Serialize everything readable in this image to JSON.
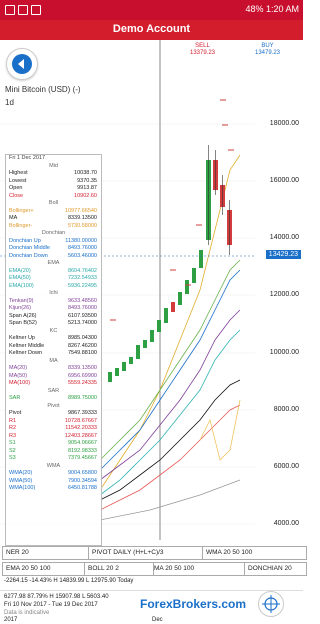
{
  "status": {
    "battery": "48%",
    "time": "1:20 AM"
  },
  "app": {
    "title": "Demo Account"
  },
  "quote": {
    "sell_label": "SELL",
    "sell_price": "13379.23",
    "buy_label": "BUY",
    "buy_price": "13479.23"
  },
  "instrument": {
    "name": "Mini Bitcoin (USD) (-)",
    "timeframe": "1d"
  },
  "price_axis": {
    "labels": [
      "18000.00",
      "16000.00",
      "14000.00",
      "12000.00",
      "10000.00",
      "8000.00",
      "6000.00",
      "4000.00"
    ],
    "current": "13429.23"
  },
  "info_panel": {
    "date": "Fri 1 Dec 2017",
    "groups": [
      {
        "head": "Mid",
        "rows": [
          [
            "Highest",
            "10038.70"
          ],
          [
            "Lowest",
            "9370.35"
          ],
          [
            "Open",
            "9913.87"
          ],
          [
            "Close",
            "10902.60"
          ]
        ]
      },
      {
        "head": "Boll",
        "rows": [
          [
            "Bollinger+",
            "10977.66540"
          ],
          [
            "MA",
            "8339.13500"
          ],
          [
            "Bollinger-",
            "5730.58000"
          ]
        ]
      },
      {
        "head": "Donchian",
        "rows": [
          [
            "Donchian Up",
            "11380.00000"
          ],
          [
            "Donchian Middle",
            "8493.76000"
          ],
          [
            "Donchian Down",
            "5603.46000"
          ]
        ]
      },
      {
        "head": "EMA",
        "rows": [
          [
            "EMA(20)",
            "8604.76402"
          ],
          [
            "EMA(50)",
            "7232.54933"
          ],
          [
            "EMA(100)",
            "5936.22495"
          ]
        ]
      },
      {
        "head": "Ichi",
        "rows": [
          [
            "Tenkan(9)",
            "9633.48560"
          ],
          [
            "Kijun(26)",
            "8493.76000"
          ],
          [
            "Span A(26)",
            "6107.93500"
          ],
          [
            "Span B(52)",
            "5213.74000"
          ]
        ]
      },
      {
        "head": "KC",
        "rows": [
          [
            "Keltner Up",
            "8985.04300"
          ],
          [
            "Keltner Middle",
            "8267.46200"
          ],
          [
            "Keltner Down",
            "7549.88100"
          ]
        ]
      },
      {
        "head": "MA",
        "rows": [
          [
            "MA(20)",
            "8339.13500"
          ],
          [
            "MA(50)",
            "6956.69900"
          ],
          [
            "MA(100)",
            "5559.24335"
          ]
        ]
      },
      {
        "head": "SAR",
        "rows": [
          [
            "SAR",
            "8989.75000"
          ]
        ]
      },
      {
        "head": "Pivot",
        "rows": [
          [
            "Pivot",
            "9867.39333"
          ],
          [
            "R1",
            "10728.67667"
          ],
          [
            "R2",
            "11542.20333"
          ],
          [
            "R3",
            "12403.28667"
          ],
          [
            "S1",
            "9054.06667"
          ],
          [
            "S2",
            "8192.98333"
          ],
          [
            "S3",
            "7379.45667"
          ]
        ]
      },
      {
        "head": "WMA",
        "rows": [
          [
            "WMA(20)",
            "9004.65800"
          ],
          [
            "WMA(50)",
            "7900.34594"
          ],
          [
            "WMA(100)",
            "6450.81788"
          ]
        ]
      }
    ]
  },
  "indicator_bar_1": {
    "pivot": "PIVOT DAILY (H+L+C)/3",
    "wma": "WMA 20 50 100",
    "kc": "NER 20",
    "ma": "MA 20 50 100"
  },
  "indicator_bar_2": {
    "ema": "EMA 20 50 100",
    "boll": "BOLL 20 2",
    "donchian": "DONCHIAN 20"
  },
  "stats": {
    "line1": "-2264.15   -14.43%   H 14839.99   L 12975.90   Today",
    "line2": "6277.98   87.79%   H 15907.98   L 5603.40",
    "line3": "Fri 10 Nov 2017 - Tue 19 Dec 2017",
    "note": "Data is indicative"
  },
  "x_axis": {
    "year": "2017",
    "month": "Dec"
  },
  "watermark": "ForexBrokers.com",
  "colors": {
    "brand": "#d31d2c",
    "up_candle": "#2ea043",
    "down_candle": "#d33c3c",
    "accent_blue": "#1a6fc9"
  }
}
